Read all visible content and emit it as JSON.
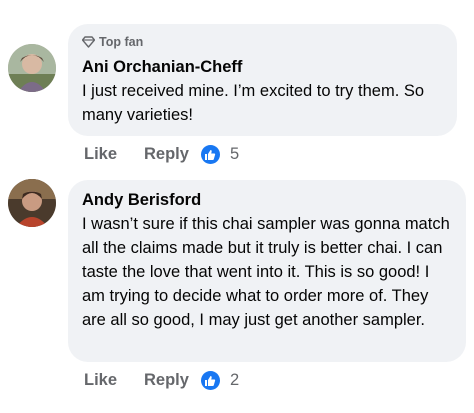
{
  "comments": [
    {
      "badge": "Top fan",
      "author": "Ani Orchanian-Cheff",
      "text": "I just received mine. I’m excited to try them. So many varieties!",
      "like_label": "Like",
      "reply_label": "Reply",
      "reaction": "like-icon",
      "reaction_count": "5"
    },
    {
      "author": "Andy Berisford",
      "text": "I wasn’t sure if this chai sampler was gonna match all the claims made but it truly is better chai. I can taste the love that went into it. This is so good! I am trying to decide what to order more of. They are all so good, I may just get another sampler.",
      "like_label": "Like",
      "reply_label": "Reply",
      "reaction": "like-icon",
      "reaction_count": "2"
    }
  ],
  "colors": {
    "bubble": "#f0f2f5",
    "secondary_text": "#65676b",
    "reaction_blue": "#1877f2"
  }
}
